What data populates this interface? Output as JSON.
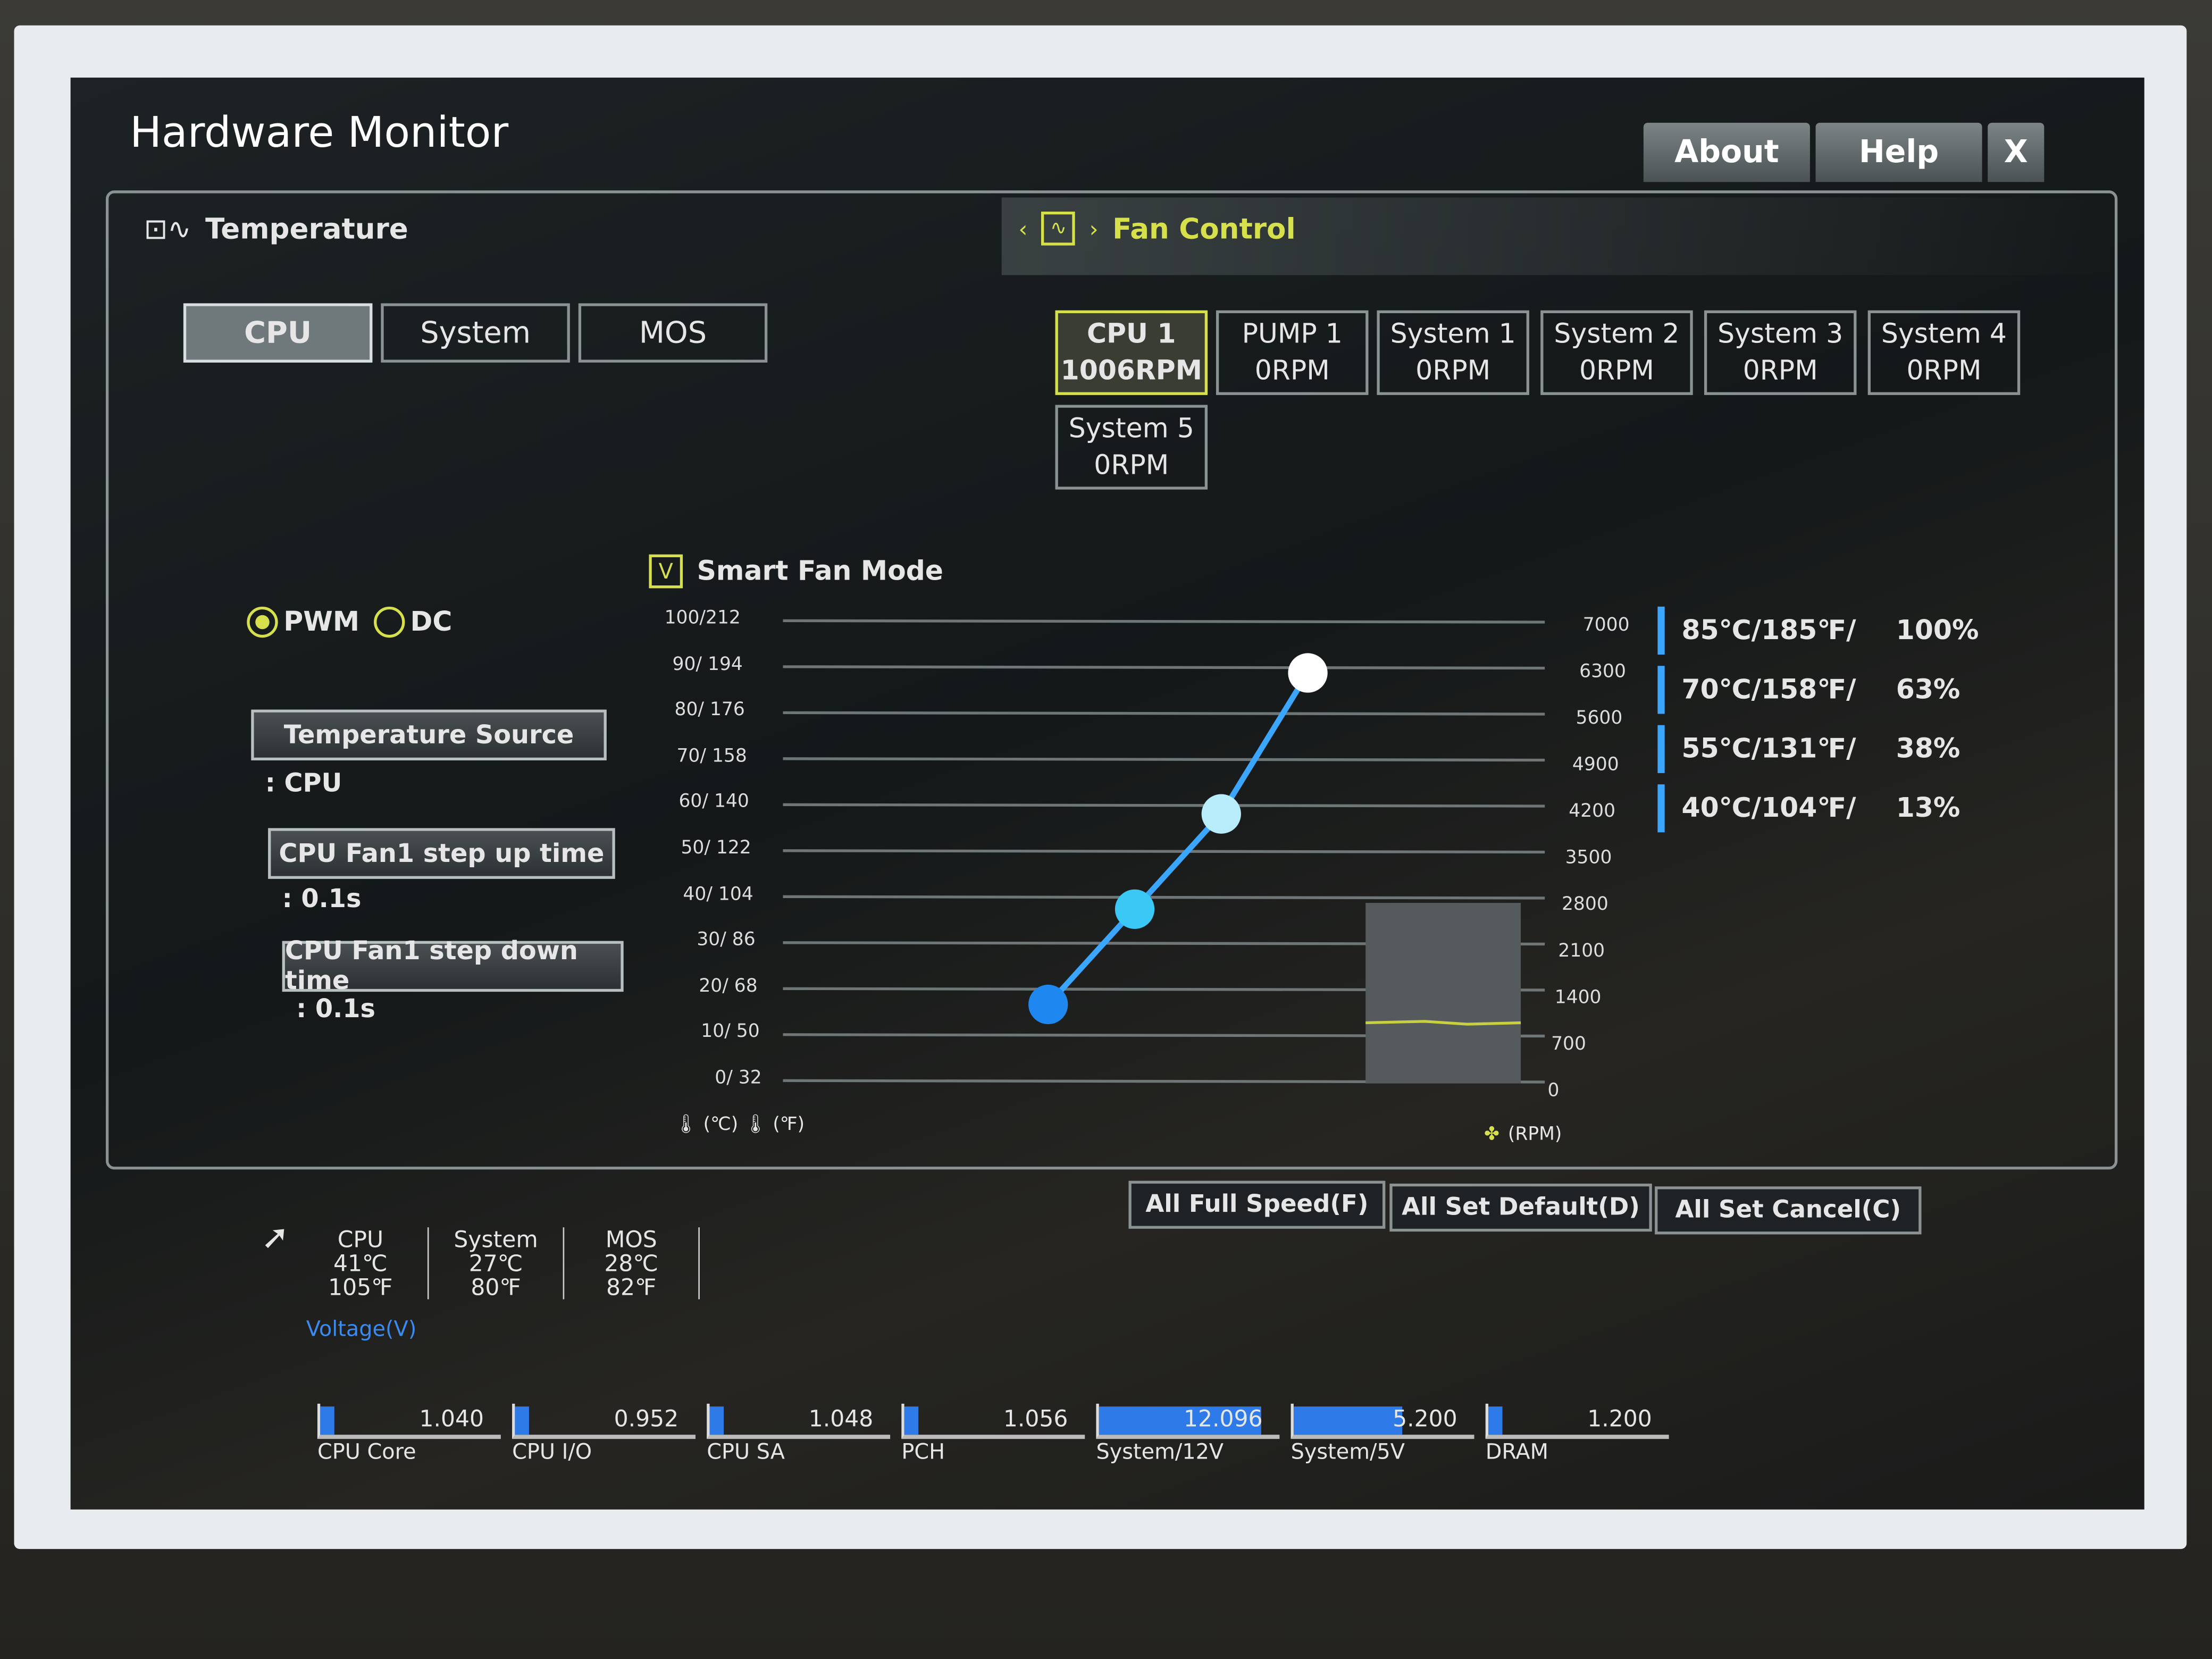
{
  "window": {
    "title": "Hardware Monitor",
    "buttons": [
      "About",
      "Help",
      "X"
    ]
  },
  "temperature": {
    "label": "Temperature",
    "tabs": [
      "CPU",
      "System",
      "MOS"
    ],
    "selected": "CPU"
  },
  "fan_control": {
    "label": "Fan Control",
    "fans": [
      {
        "name": "CPU 1",
        "speed": "1006RPM",
        "selected": true
      },
      {
        "name": "PUMP 1",
        "speed": "0RPM"
      },
      {
        "name": "System 1",
        "speed": "0RPM"
      },
      {
        "name": "System 2",
        "speed": "0RPM"
      },
      {
        "name": "System 3",
        "speed": "0RPM"
      },
      {
        "name": "System 4",
        "speed": "0RPM"
      },
      {
        "name": "System 5",
        "speed": "0RPM"
      }
    ]
  },
  "mode": {
    "pwm": "PWM",
    "dc": "DC",
    "selected": "PWM"
  },
  "settings": [
    {
      "label": "Temperature Source",
      "value": ": CPU"
    },
    {
      "label": "CPU Fan1 step up time",
      "value": ": 0.1s"
    },
    {
      "label": "CPU Fan1 step down time",
      "value": ": 0.1s"
    }
  ],
  "smart_fan": {
    "label": "Smart Fan Mode",
    "checked": true,
    "check_glyph": "V",
    "temp_ticks": [
      "100/212",
      "90/ 194",
      "80/ 176",
      "70/ 158",
      "60/ 140",
      "50/ 122",
      "40/ 104",
      "30/  86",
      "20/  68",
      "10/  50",
      "0/  32"
    ],
    "rpm_ticks": [
      "7000",
      "6300",
      "5600",
      "4900",
      "4200",
      "3500",
      "2800",
      "2100",
      "1400",
      "700",
      "0"
    ],
    "unit_c": "(℃)",
    "unit_f": "(℉)",
    "unit_rpm": "(RPM)",
    "points": [
      {
        "temp_c": 40,
        "percent": 13
      },
      {
        "temp_c": 55,
        "percent": 38
      },
      {
        "temp_c": 70,
        "percent": 63
      },
      {
        "temp_c": 85,
        "percent": 100
      }
    ],
    "legend": [
      {
        "temp": "85℃/185℉/",
        "pct": "100%"
      },
      {
        "temp": "70℃/158℉/",
        "pct": "63%"
      },
      {
        "temp": "55℃/131℉/",
        "pct": "38%"
      },
      {
        "temp": "40℃/104℉/",
        "pct": "13%"
      }
    ],
    "colors": {
      "line": "#3aa6ff",
      "accent": "#d6e04a"
    }
  },
  "actions": [
    "All Full Speed(F)",
    "All Set Default(D)",
    "All Set Cancel(C)"
  ],
  "temps": [
    {
      "name": "CPU",
      "c": "41℃",
      "f": "105℉"
    },
    {
      "name": "System",
      "c": "27℃",
      "f": "80℉"
    },
    {
      "name": "MOS",
      "c": "28℃",
      "f": "82℉"
    }
  ],
  "voltage": {
    "label": "Voltage(V)",
    "items": [
      {
        "name": "CPU Core",
        "value": "1.040",
        "fill": 0.08
      },
      {
        "name": "CPU I/O",
        "value": "0.952",
        "fill": 0.08
      },
      {
        "name": "CPU SA",
        "value": "1.048",
        "fill": 0.08
      },
      {
        "name": "PCH",
        "value": "1.056",
        "fill": 0.08
      },
      {
        "name": "System/12V",
        "value": "12.096",
        "fill": 0.9
      },
      {
        "name": "System/5V",
        "value": "5.200",
        "fill": 0.6
      },
      {
        "name": "DRAM",
        "value": "1.200",
        "fill": 0.08
      }
    ]
  }
}
